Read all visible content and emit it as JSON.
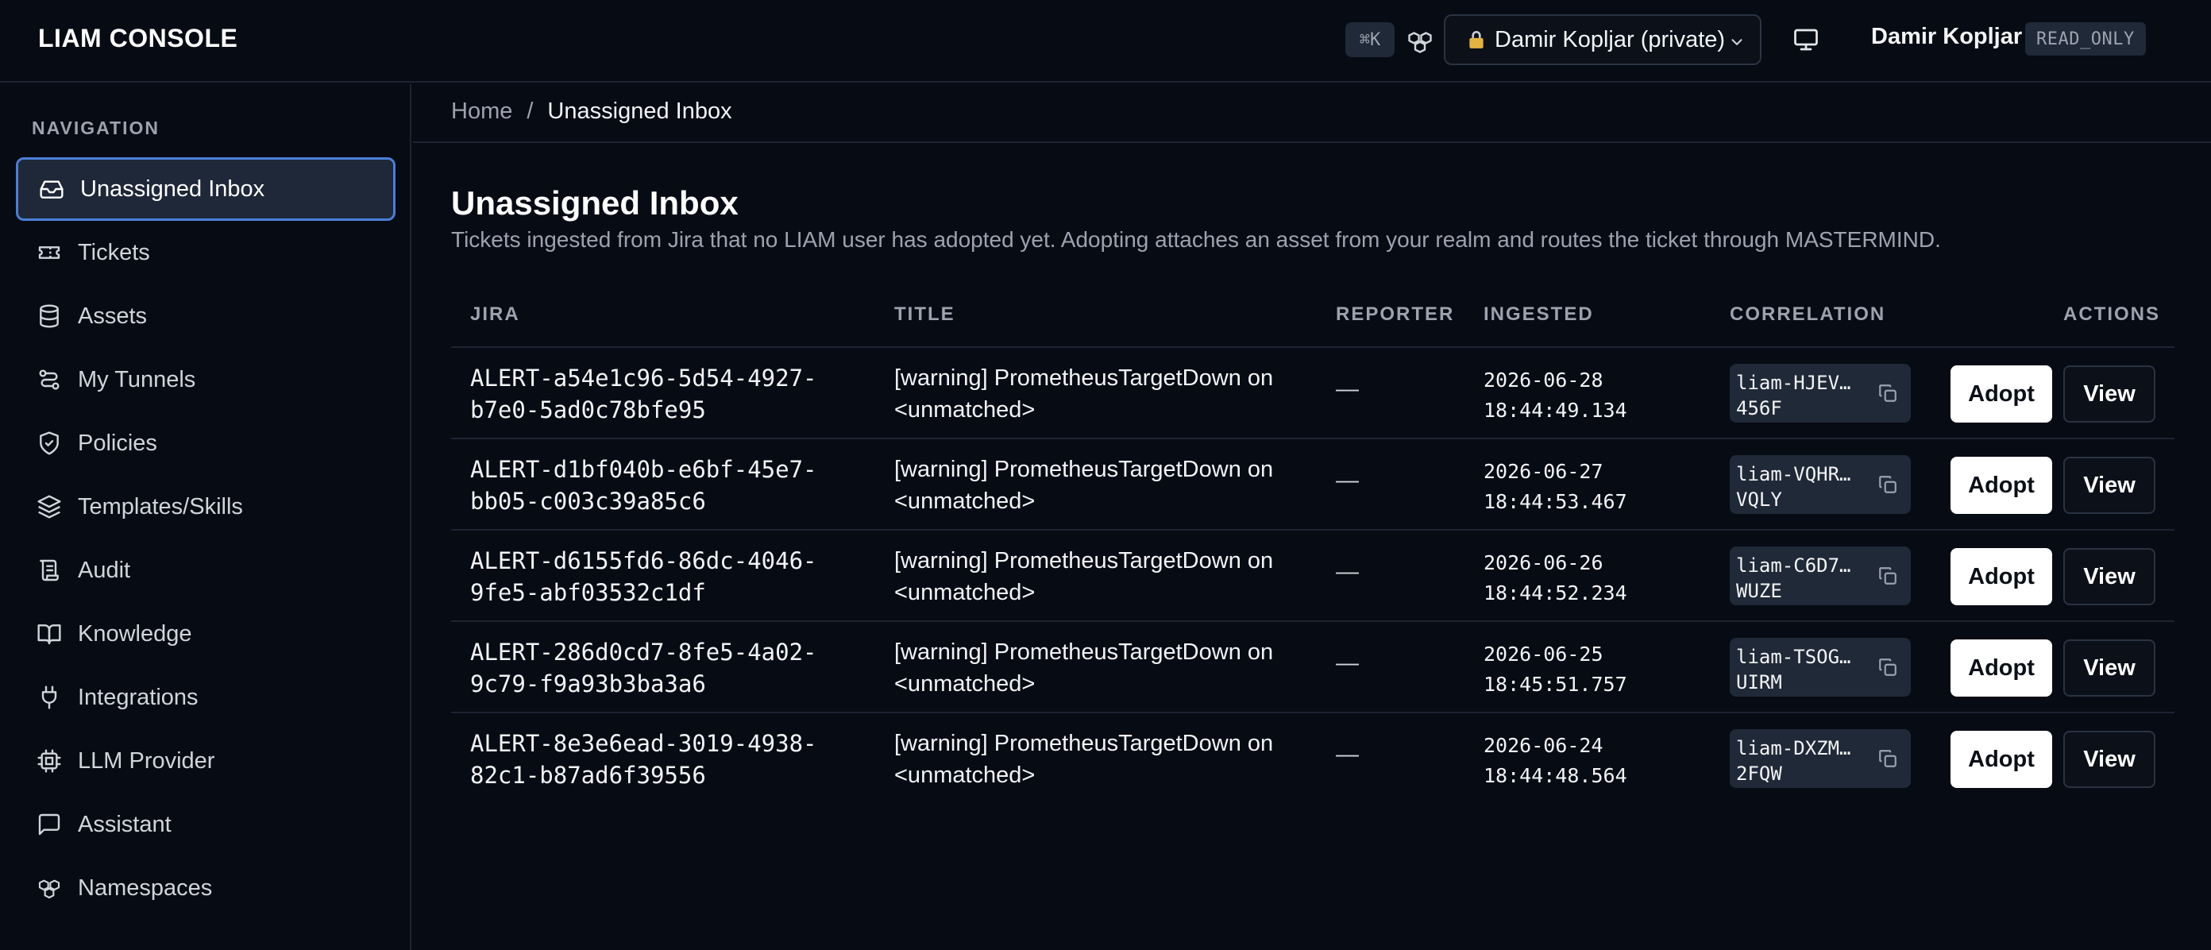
{
  "header": {
    "brand": "LIAM CONSOLE",
    "shortcut": "⌘K",
    "realm": "Damir Kopljar (private)",
    "user_name": "Damir Kopljar",
    "role": "READ_ONLY"
  },
  "sidebar": {
    "heading": "NAVIGATION",
    "items": [
      {
        "label": "Unassigned Inbox",
        "icon": "inbox-icon"
      },
      {
        "label": "Tickets",
        "icon": "ticket-icon"
      },
      {
        "label": "Assets",
        "icon": "database-icon"
      },
      {
        "label": "My Tunnels",
        "icon": "tunnel-icon"
      },
      {
        "label": "Policies",
        "icon": "shield-check-icon"
      },
      {
        "label": "Templates/Skills",
        "icon": "layers-icon"
      },
      {
        "label": "Audit",
        "icon": "scroll-icon"
      },
      {
        "label": "Knowledge",
        "icon": "book-icon"
      },
      {
        "label": "Integrations",
        "icon": "plug-icon"
      },
      {
        "label": "LLM Provider",
        "icon": "cpu-icon"
      },
      {
        "label": "Assistant",
        "icon": "message-icon"
      },
      {
        "label": "Namespaces",
        "icon": "boxes-icon"
      }
    ]
  },
  "breadcrumb": {
    "home": "Home",
    "separator": "/",
    "current": "Unassigned Inbox"
  },
  "page": {
    "title": "Unassigned Inbox",
    "description": "Tickets ingested from Jira that no LIAM user has adopted yet. Adopting attaches an asset from your realm and routes the ticket through MASTERMIND."
  },
  "table": {
    "columns": {
      "jira": "JIRA",
      "title": "TITLE",
      "reporter": "REPORTER",
      "ingested": "INGESTED",
      "correlation": "CORRELATION",
      "actions": "ACTIONS"
    },
    "adopt_label": "Adopt",
    "view_label": "View",
    "rows": [
      {
        "jira_1": "ALERT-a54e1c96-5d54-4927-",
        "jira_2": "b7e0-5ad0c78bfe95",
        "title_1": "[warning] PrometheusTargetDown on",
        "title_2": "<unmatched>",
        "reporter": "—",
        "date": "2026-06-28",
        "time": "18:44:49.134",
        "corr_1": "liam-HJEV…",
        "corr_2": "456F"
      },
      {
        "jira_1": "ALERT-d1bf040b-e6bf-45e7-",
        "jira_2": "bb05-c003c39a85c6",
        "title_1": "[warning] PrometheusTargetDown on",
        "title_2": "<unmatched>",
        "reporter": "—",
        "date": "2026-06-27",
        "time": "18:44:53.467",
        "corr_1": "liam-VQHR…",
        "corr_2": "VQLY"
      },
      {
        "jira_1": "ALERT-d6155fd6-86dc-4046-",
        "jira_2": "9fe5-abf03532c1df",
        "title_1": "[warning] PrometheusTargetDown on",
        "title_2": "<unmatched>",
        "reporter": "—",
        "date": "2026-06-26",
        "time": "18:44:52.234",
        "corr_1": "liam-C6D7…",
        "corr_2": "WUZE"
      },
      {
        "jira_1": "ALERT-286d0cd7-8fe5-4a02-",
        "jira_2": "9c79-f9a93b3ba3a6",
        "title_1": "[warning] PrometheusTargetDown on",
        "title_2": "<unmatched>",
        "reporter": "—",
        "date": "2026-06-25",
        "time": "18:45:51.757",
        "corr_1": "liam-TSOG…",
        "corr_2": "UIRM"
      },
      {
        "jira_1": "ALERT-8e3e6ead-3019-4938-",
        "jira_2": "82c1-b87ad6f39556",
        "title_1": "[warning] PrometheusTargetDown on",
        "title_2": "<unmatched>",
        "reporter": "—",
        "date": "2026-06-24",
        "time": "18:44:48.564",
        "corr_1": "liam-DXZM…",
        "corr_2": "2FQW"
      }
    ]
  }
}
